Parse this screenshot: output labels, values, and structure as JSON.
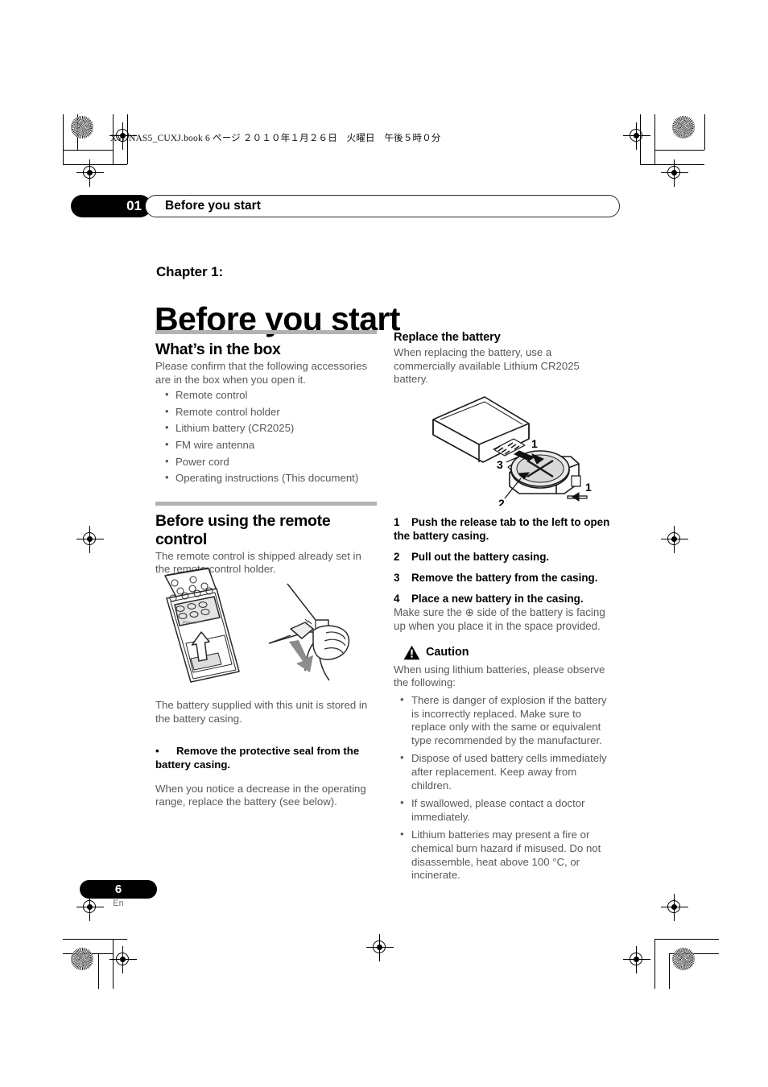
{
  "file_info": "XW-NAS5_CUXJ.book   6 ページ   ２０１０年１月２６日　火曜日　午後５時０分",
  "running_header": {
    "chapter_number": "01",
    "chapter_title": "Before you start"
  },
  "chapter": {
    "label": "Chapter 1:",
    "title": "Before you start"
  },
  "left_column": {
    "whats_in_the_box": {
      "heading": "What’s in the box",
      "intro": "Please confirm that the following accessories are in the box when you open it.",
      "items": [
        "Remote control",
        "Remote control holder",
        "Lithium battery (CR2025)",
        "FM wire antenna",
        "Power cord",
        "Operating instructions (This document)"
      ]
    },
    "before_using_remote": {
      "heading": "Before using the remote control",
      "intro": "The remote control is shipped already set in the remote control holder.",
      "figure_caption_alt": "Remote control in holder and hand pulling protective seal",
      "after_figure": "The battery supplied with this unit is stored in the battery casing.",
      "seal_bullet": "Remove the protective seal from the battery casing.",
      "seal_note": "When you notice a decrease in the operating range, replace the battery (see below)."
    }
  },
  "right_column": {
    "replace_battery": {
      "heading": "Replace the battery",
      "intro": "When replacing the battery, use a commercially available Lithium CR2025 battery.",
      "figure_labels": [
        "1",
        "2",
        "3",
        "1"
      ],
      "steps": [
        {
          "number": "1",
          "text": "Push the release tab to the left to open the battery casing."
        },
        {
          "number": "2",
          "text": "Pull out the battery casing."
        },
        {
          "number": "3",
          "text": "Remove the battery from the casing."
        },
        {
          "number": "4",
          "text": "Place a new battery in the casing.",
          "note": "Make sure the ⊕ side of the battery is facing up when you place it in the space provided."
        }
      ]
    },
    "caution": {
      "label": "Caution",
      "intro": "When using lithium batteries, please observe the following:",
      "items": [
        "There is danger of explosion if the battery is incorrectly replaced. Make sure to replace only with the same or equivalent type recommended by the manufacturer.",
        "Dispose of used battery cells immediately after replacement. Keep away from children.",
        "If swallowed, please contact a doctor immediately.",
        "Lithium batteries may present a fire or chemical burn hazard if misused. Do not disassemble, heat above 100 °C, or incinerate."
      ]
    }
  },
  "footer": {
    "page_number": "6",
    "language": "En"
  },
  "colors": {
    "body_text": "#58585a",
    "heading_text": "#000000",
    "rule": "#b2b2b2",
    "chip_background": "#000000"
  }
}
